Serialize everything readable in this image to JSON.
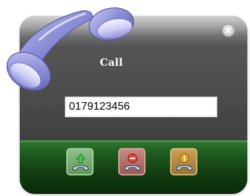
{
  "dialog": {
    "title": "Call",
    "phone_number": "0179123456"
  },
  "icons": {
    "handset": "phone-handset-icon",
    "close": "close-icon",
    "call": "call-icon",
    "hangup": "hangup-icon",
    "info": "info-icon"
  },
  "colors": {
    "handset": "#8e8fd6",
    "footer": "#1f5a1f",
    "body": "#4b4b4b",
    "call_button": "#7aad75",
    "hangup_button": "#b5736d",
    "info_button": "#b98d46"
  }
}
